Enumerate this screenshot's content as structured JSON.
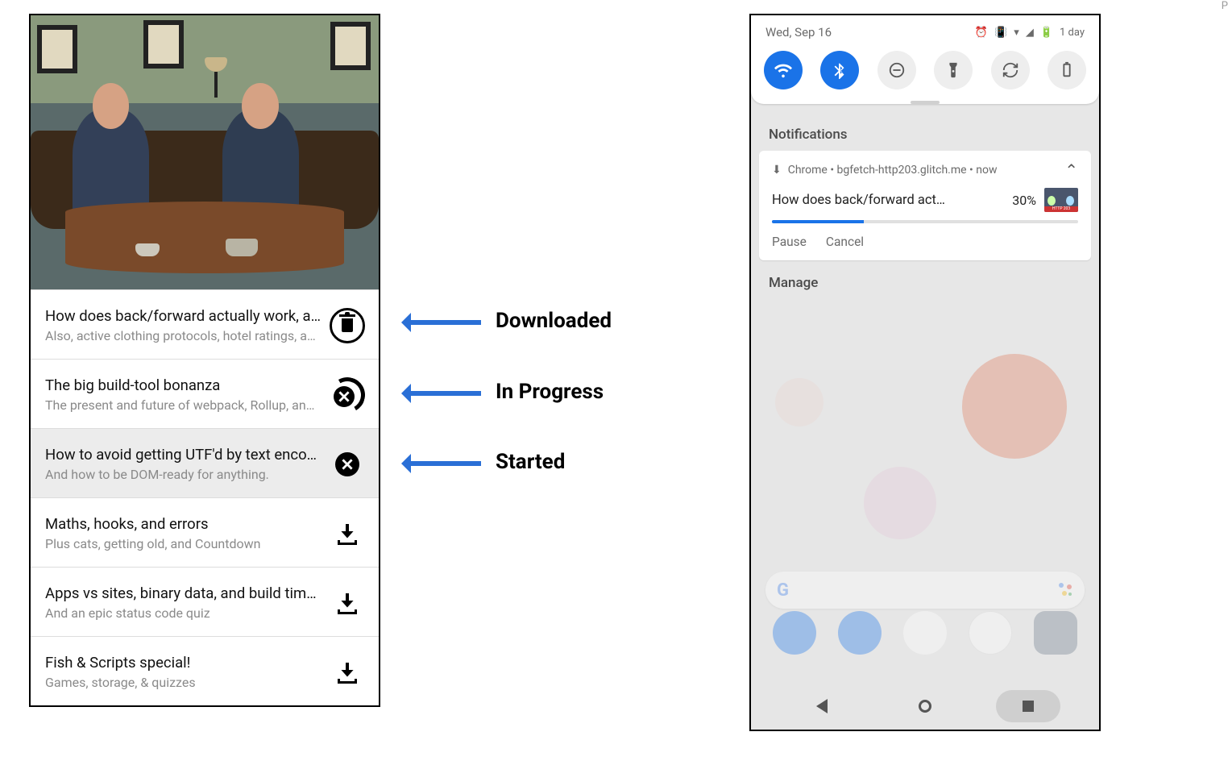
{
  "annotations": {
    "downloaded": "Downloaded",
    "in_progress": "In Progress",
    "started": "Started"
  },
  "app": {
    "items": [
      {
        "title": "How does back/forward actually work, an…",
        "subtitle": "Also, active clothing protocols, hotel ratings, a…",
        "state": "downloaded"
      },
      {
        "title": "The big build-tool bonanza",
        "subtitle": "The present and future of webpack, Rollup, an…",
        "state": "in_progress"
      },
      {
        "title": "How to avoid getting UTF'd by text encodi…",
        "subtitle": "And how to be DOM-ready for anything.",
        "state": "started",
        "selected": true
      },
      {
        "title": "Maths, hooks, and errors",
        "subtitle": "Plus cats, getting old, and Countdown",
        "state": "idle"
      },
      {
        "title": "Apps vs sites, binary data, and build times",
        "subtitle": "And an epic status code quiz",
        "state": "idle"
      },
      {
        "title": "Fish & Scripts special!",
        "subtitle": "Games, storage, & quizzes",
        "state": "idle"
      }
    ]
  },
  "phone": {
    "status": {
      "date": "Wed, Sep 16",
      "battery_text": "1 day"
    },
    "notifications_label": "Notifications",
    "manage_label": "Manage",
    "quick_settings": [
      {
        "name": "wifi",
        "active": true
      },
      {
        "name": "bluetooth",
        "active": true
      },
      {
        "name": "dnd",
        "active": false
      },
      {
        "name": "flashlight",
        "active": false
      },
      {
        "name": "auto_rotate",
        "active": false
      },
      {
        "name": "battery_saver",
        "active": false
      }
    ],
    "notification": {
      "app_line": "Chrome  •  bgfetch-http203.glitch.me  •  now",
      "title": "How does back/forward act…",
      "percent_label": "30%",
      "progress_pct": 30,
      "thumb_caption": "HTTP 203",
      "actions": {
        "pause": "Pause",
        "cancel": "Cancel"
      }
    },
    "nav": [
      "back",
      "home",
      "recent"
    ]
  },
  "colors": {
    "accent": "#1a73e8",
    "arrow": "#2a6fd6"
  }
}
